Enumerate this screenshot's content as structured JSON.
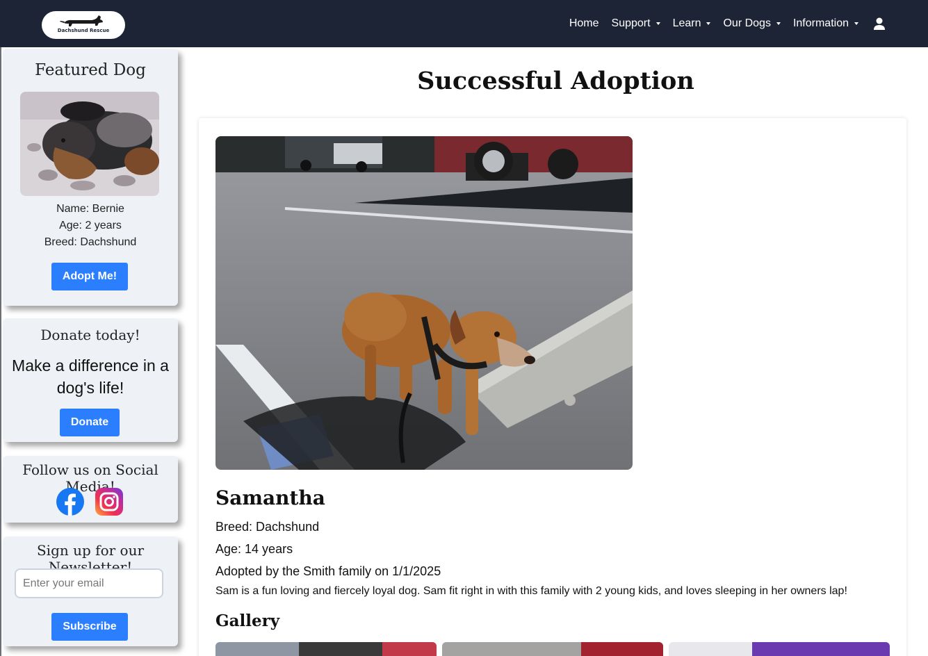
{
  "nav": {
    "logo_text": "Dachshund Rescue",
    "items": [
      {
        "label": "Home",
        "dropdown": false
      },
      {
        "label": "Support",
        "dropdown": true
      },
      {
        "label": "Learn",
        "dropdown": true
      },
      {
        "label": "Our Dogs",
        "dropdown": true
      },
      {
        "label": "Information",
        "dropdown": true
      }
    ],
    "account_icon": "user-icon"
  },
  "sidebar": {
    "featured": {
      "title": "Featured Dog",
      "name": "Name: Bernie",
      "age": "Age: 2 years",
      "breed": "Breed: Dachshund",
      "button": "Adopt Me!"
    },
    "donate": {
      "title": "Donate today!",
      "tagline": "Make a difference in a dog's life!",
      "button": "Donate"
    },
    "social": {
      "title": "Follow us on Social Media!",
      "icons": [
        "facebook-icon",
        "instagram-icon"
      ]
    },
    "newsletter": {
      "title": "Sign up for our Newsletter!",
      "placeholder": "Enter your email",
      "button": "Subscribe"
    }
  },
  "main": {
    "title": "Successful Adoption",
    "dog": {
      "name": "Samantha",
      "breed": "Breed: Dachshund",
      "age": "Age: 14 years",
      "adopted": "Adopted by the Smith family on 1/1/2025",
      "description": "Sam is a fun loving and fiercely loyal dog. Sam fit right in with this family with 2 young kids, and loves sleeping in her owners lap!"
    },
    "gallery_title": "Gallery"
  },
  "colors": {
    "navbar": "#1c2436",
    "button": "#2b7fff",
    "card": "#eef2f7"
  }
}
